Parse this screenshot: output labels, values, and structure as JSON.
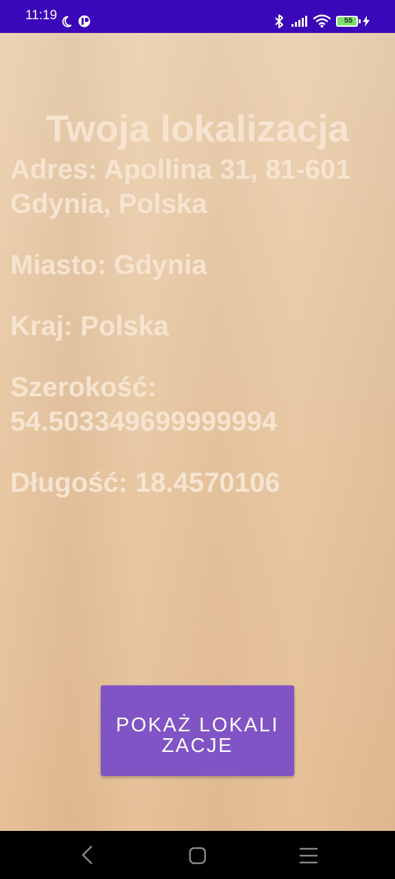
{
  "status_bar": {
    "time": "11:19",
    "battery_level": "55",
    "icons": [
      "moon-icon",
      "app-notification-icon",
      "bluetooth-icon",
      "signal-icon",
      "wifi-icon",
      "battery-icon",
      "charging-icon"
    ]
  },
  "location": {
    "title": "Twoja lokalizacja",
    "address": "Adres: Apollina 31, 81-601 Gdynia, Polska",
    "city": "Miasto: Gdynia",
    "country": "Kraj: Polska",
    "latitude": "Szerokość: 54.503349699999994",
    "longitude": "Długość: 18.4570106"
  },
  "actions": {
    "show_location": "POKAŻ LOKALIZACJE"
  },
  "navigation": {
    "icons": [
      "back-icon",
      "home-icon",
      "menu-icon"
    ]
  },
  "colors": {
    "status_bar": "#3a08b8",
    "background": "#e8c39a",
    "text": "#f6e4d1",
    "button": "#8054c4",
    "navigation": "#000000"
  }
}
